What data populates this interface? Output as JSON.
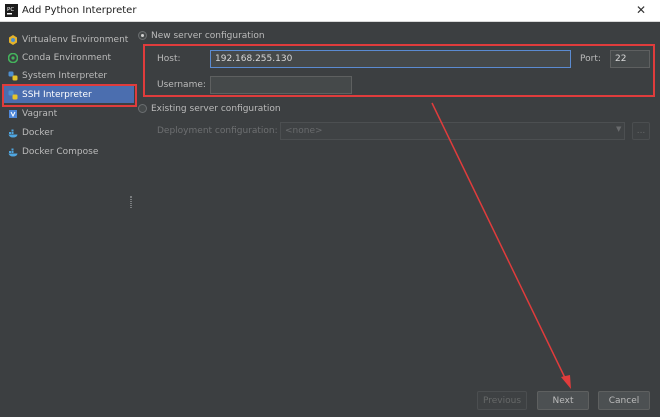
{
  "window": {
    "title": "Add Python Interpreter",
    "close_glyph": "✕"
  },
  "sidebar": {
    "items": [
      {
        "label": "Virtualenv Environment",
        "icon": "virtualenv-icon",
        "color": "#e4b22b"
      },
      {
        "label": "Conda Environment",
        "icon": "conda-icon",
        "color": "#44b35c"
      },
      {
        "label": "System Interpreter",
        "icon": "python-icon",
        "color": "#4e8fcf"
      },
      {
        "label": "SSH Interpreter",
        "icon": "ssh-icon",
        "color": "#e4b22b",
        "selected": true
      },
      {
        "label": "Vagrant",
        "icon": "vagrant-icon",
        "color": "#4f87d8"
      },
      {
        "label": "Docker",
        "icon": "docker-icon",
        "color": "#4fa6e0"
      },
      {
        "label": "Docker Compose",
        "icon": "docker-compose-icon",
        "color": "#4fa6e0"
      }
    ]
  },
  "main": {
    "new_server": {
      "label": "New server configuration",
      "checked": true
    },
    "host": {
      "label": "Host:",
      "value": "192.168.255.130"
    },
    "port": {
      "label": "Port:",
      "value": "22"
    },
    "username": {
      "label": "Username:",
      "value": ""
    },
    "existing_server": {
      "label": "Existing server configuration",
      "checked": false
    },
    "deployment": {
      "label": "Deployment configuration:",
      "value": "<none>",
      "browse_label": "..."
    }
  },
  "footer": {
    "previous_label": "Previous",
    "next_label": "Next",
    "cancel_label": "Cancel"
  },
  "colors": {
    "accent": "#4b6eaf",
    "annotation_red": "#e03c3c",
    "background": "#3c3f41"
  }
}
